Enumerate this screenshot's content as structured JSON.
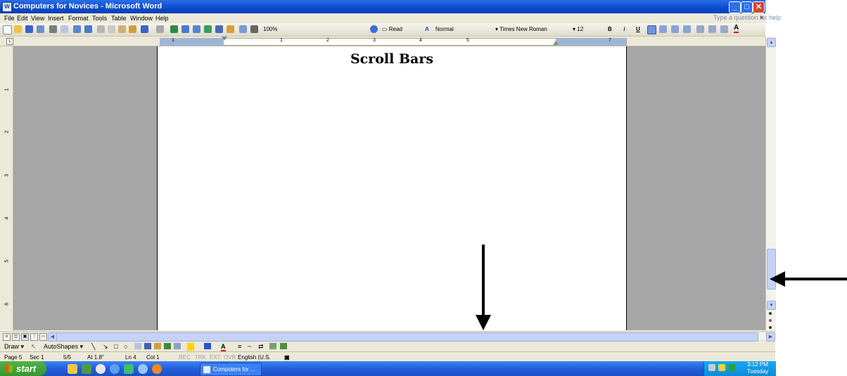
{
  "window": {
    "title": "Computers for Novices - Microsoft Word",
    "controls": {
      "minimize": "_",
      "maximize": "□",
      "close": "✕"
    }
  },
  "menubar": {
    "items": [
      "File",
      "Edit",
      "View",
      "Insert",
      "Format",
      "Tools",
      "Table",
      "Window",
      "Help"
    ],
    "help_placeholder": "Type a question for help",
    "close_doc": "×"
  },
  "toolbar": {
    "zoom": "100%",
    "read_label": "Read",
    "style": "Normal",
    "font": "Times New Roman",
    "font_size": "12",
    "bold": "B",
    "italic": "I",
    "underline": "U",
    "font_color": "A"
  },
  "ruler": {
    "numbers": [
      "1",
      "1",
      "2",
      "3",
      "4",
      "5",
      "7"
    ]
  },
  "vruler": {
    "numbers": [
      "1",
      "2",
      "3",
      "4",
      "5",
      "6"
    ]
  },
  "document": {
    "heading": "Scroll Bars"
  },
  "drawbar": {
    "draw": "Draw",
    "autoshapes": "AutoShapes"
  },
  "status": {
    "page": "Page 5",
    "sec": "Sec 1",
    "pages": "5/5",
    "at": "At 1.8\"",
    "ln": "Ln 4",
    "col": "Col 1",
    "rec": "REC",
    "trk": "TRK",
    "ext": "EXT",
    "ovr": "OVR",
    "language": "English (U.S."
  },
  "taskbar": {
    "start": "start",
    "task": "Computers for ...",
    "time": "3:12 PM",
    "day": "Tuesday"
  },
  "colors": {
    "title_blue": "#0a4bd0",
    "taskbar_blue": "#245edc",
    "start_green": "#37962f",
    "scroll_blue": "#c6d3f7"
  }
}
